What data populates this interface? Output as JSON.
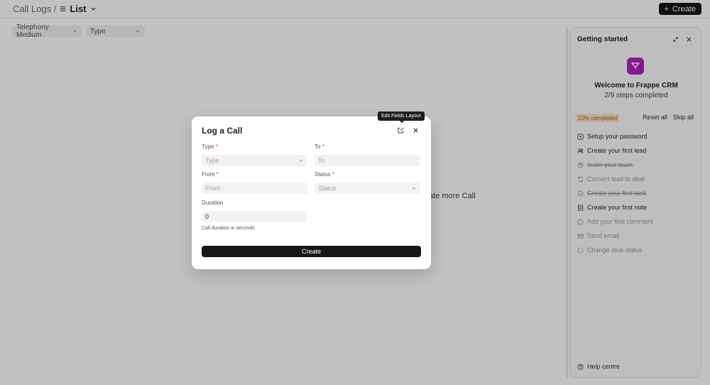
{
  "header": {
    "breadcrumb_parent": "Call Logs /",
    "breadcrumb_current": "List",
    "create_label": "Create"
  },
  "filters": [
    {
      "label": "Telephony Medium"
    },
    {
      "label": "Type"
    }
  ],
  "empty_state": {
    "text": "eate more Call"
  },
  "panel": {
    "title": "Getting started",
    "welcome": "Welcome to Frappe CRM",
    "steps": "2/9 steps completed",
    "progress": "22% completed",
    "reset_label": "Reset all",
    "skip_label": "Skip all",
    "tasks": [
      {
        "label": "Setup your password",
        "icon": "key-icon",
        "state": "normal"
      },
      {
        "label": "Create your first lead",
        "icon": "users-icon",
        "state": "normal"
      },
      {
        "label": "Invite your team",
        "icon": "user-plus-icon",
        "state": "done"
      },
      {
        "label": "Convert lead to deal",
        "icon": "refresh-icon",
        "state": "faded"
      },
      {
        "label": "Create your first task",
        "icon": "check-circle-icon",
        "state": "done"
      },
      {
        "label": "Create your first note",
        "icon": "note-icon",
        "state": "normal"
      },
      {
        "label": "Add your first comment",
        "icon": "comment-icon",
        "state": "faded"
      },
      {
        "label": "Send email",
        "icon": "mail-icon",
        "state": "faded"
      },
      {
        "label": "Change deal status",
        "icon": "status-icon",
        "state": "faded"
      }
    ],
    "help_label": "Help centre"
  },
  "modal": {
    "title": "Log a Call",
    "tooltip": "Edit Fields Layout",
    "fields": {
      "type": {
        "label": "Type",
        "placeholder": "Type"
      },
      "to": {
        "label": "To",
        "placeholder": "To"
      },
      "from": {
        "label": "From",
        "placeholder": "From"
      },
      "status": {
        "label": "Status",
        "placeholder": "Status"
      },
      "duration": {
        "label": "Duration",
        "value": "0",
        "help": "Call duration in seconds"
      }
    },
    "required_mark": "*",
    "create_label": "Create"
  },
  "colors": {
    "brand": "#b41fbd",
    "primary_button": "#171717",
    "progress_text": "#b85c0a",
    "required": "#e03e3e"
  }
}
